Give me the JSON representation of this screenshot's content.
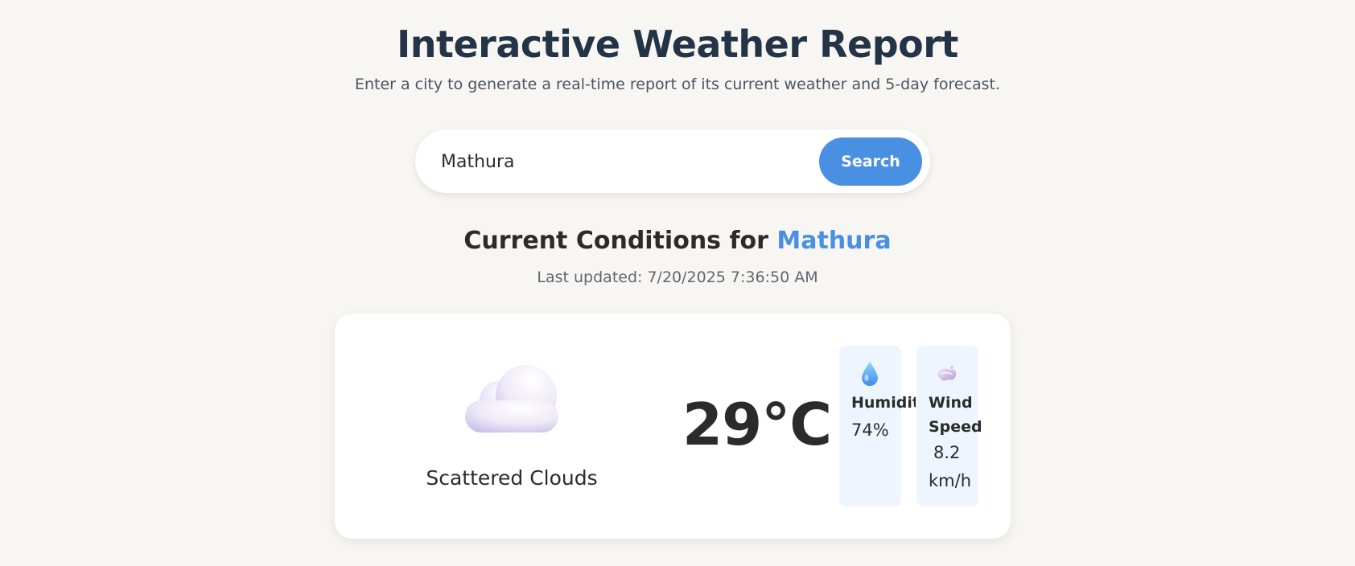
{
  "header": {
    "title": "Interactive Weather Report",
    "subtitle": "Enter a city to generate a real-time report of its current weather and 5-day forecast."
  },
  "search": {
    "value": "Mathura",
    "placeholder": "",
    "button_label": "Search"
  },
  "current": {
    "heading_prefix": "Current Conditions for",
    "city": "Mathura",
    "last_updated": "Last updated: 7/20/2025 7:36:50 AM",
    "icon": "cloud-icon",
    "description": "Scattered Clouds",
    "temperature": "29°C",
    "humidity": {
      "icon": "droplet-icon",
      "label": "Humidity",
      "value": "74%"
    },
    "wind": {
      "icon": "wind-icon",
      "label": "Wind Speed",
      "value": "8.2 km/h"
    }
  },
  "colors": {
    "accent": "#4a90e2",
    "background": "#f7f6f3",
    "stat_box": "#eef5fe",
    "title": "#243447"
  }
}
